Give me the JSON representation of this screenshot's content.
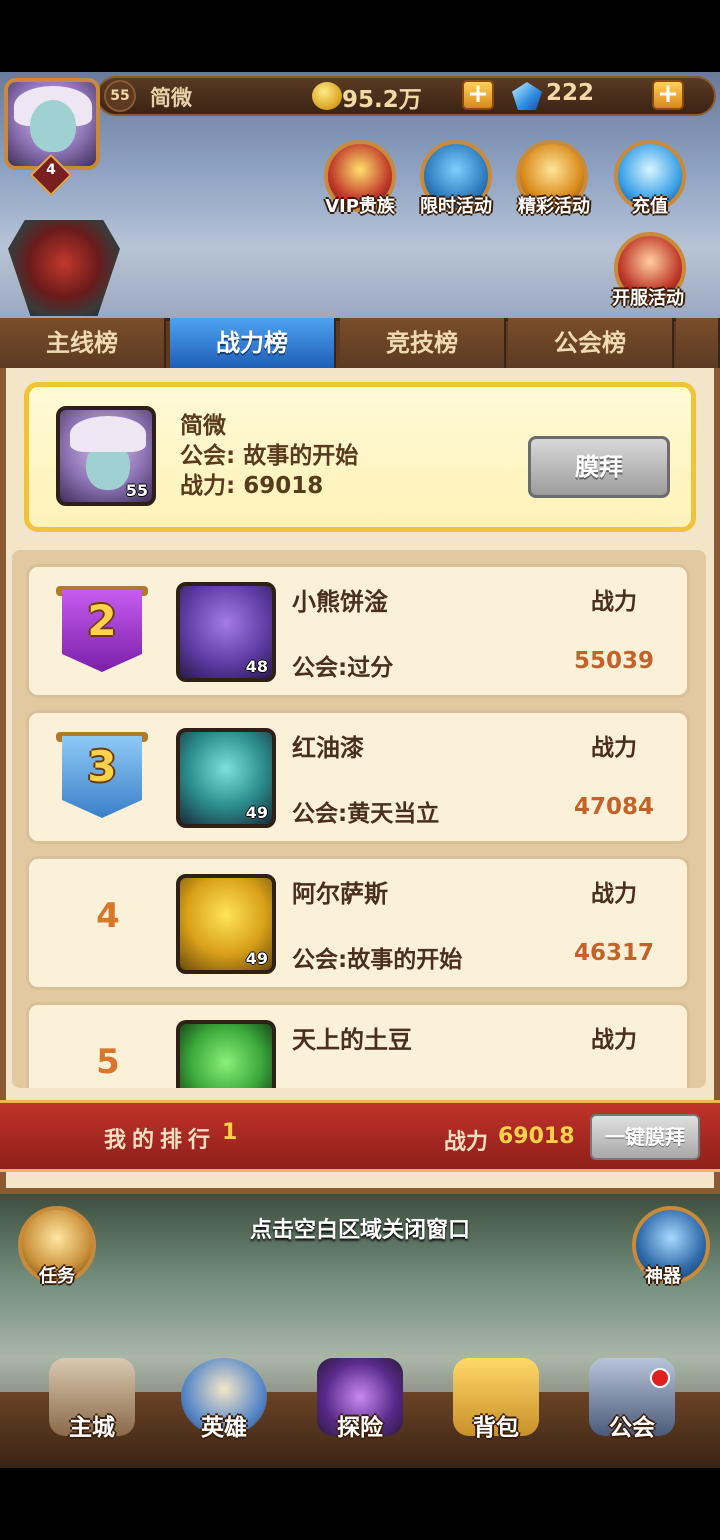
{
  "player": {
    "level": "55",
    "name": "简微",
    "vip": "4",
    "gold": "95.2万",
    "gems": "222"
  },
  "events": [
    {
      "label": "VIP贵族",
      "icon": "crown-icon",
      "color": "#c0392b"
    },
    {
      "label": "限时活动",
      "icon": "compass-icon",
      "color": "#2e7bbf"
    },
    {
      "label": "精彩活动",
      "icon": "chest-icon",
      "color": "#d98a1a"
    },
    {
      "label": "充值",
      "icon": "diamond-icon",
      "color": "#3aa0e8"
    },
    {
      "label": "开服活动",
      "icon": "gift-icon",
      "color": "#c0392b"
    }
  ],
  "tabs": [
    "主线榜",
    "战力榜",
    "竞技榜",
    "公会榜"
  ],
  "active_tab": "战力榜",
  "my_card": {
    "name": "简微",
    "guild_line": "公会: 故事的开始",
    "power_line": "战力: 69018",
    "level": "55",
    "worship_label": "膜拜"
  },
  "ranking": [
    {
      "rank": "2",
      "name": "小熊饼淦",
      "guild": "公会:过分",
      "power_label": "战力",
      "power": "55039",
      "level": "48",
      "banner_color": "#a93bd6"
    },
    {
      "rank": "3",
      "name": "红油漆",
      "guild": "公会:黄天当立",
      "power_label": "战力",
      "power": "47084",
      "level": "49",
      "banner_color": "#5aa6e8"
    },
    {
      "rank": "4",
      "name": "阿尔萨斯",
      "guild": "公会:故事的开始",
      "power_label": "战力",
      "power": "46317",
      "level": "49"
    },
    {
      "rank": "5",
      "name": "天上的土豆",
      "guild": "",
      "power_label": "战力",
      "power": ""
    }
  ],
  "my_rank_bar": {
    "label": "我的排行",
    "rank": "1",
    "power_label": "战力",
    "power": "69018",
    "all_worship_label": "一键膜拜"
  },
  "close_hint": "点击空白区域关闭窗口",
  "side_buttons": {
    "left": "任务",
    "right": "神器"
  },
  "nav": [
    "主城",
    "英雄",
    "探险",
    "背包",
    "公会"
  ]
}
